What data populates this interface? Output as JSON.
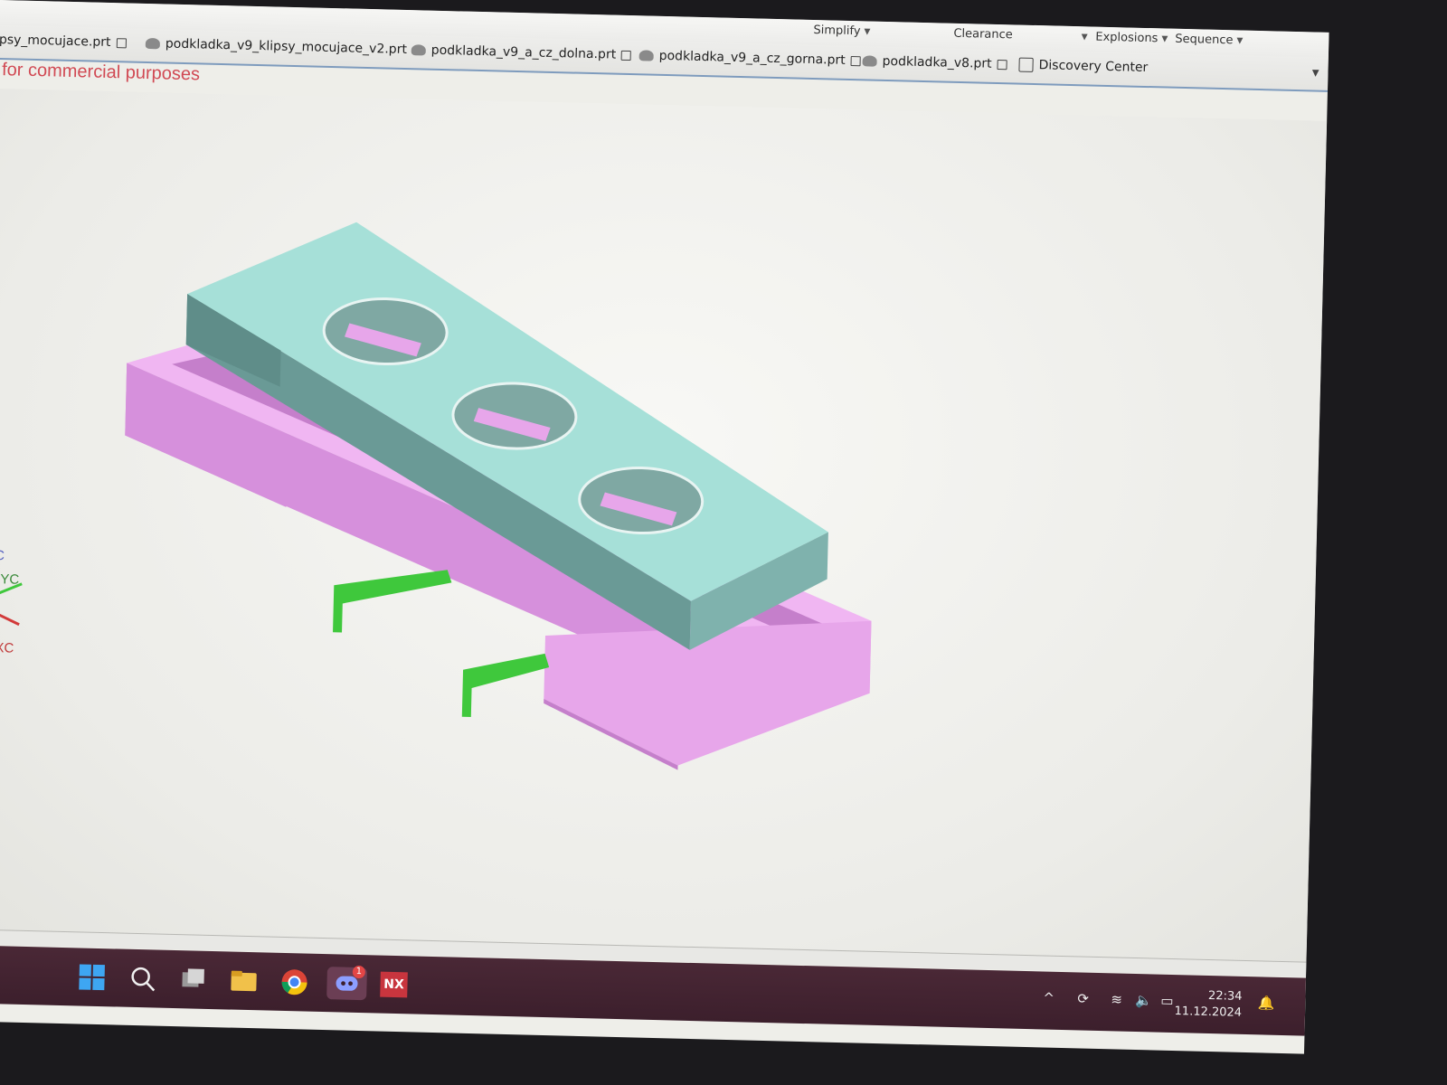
{
  "ribbon": {
    "simplify": "Simplify",
    "clearance": "Clearance",
    "explosions": "Explosions",
    "sequence": "Sequence"
  },
  "tabs": [
    {
      "label": "psy_mocujace.prt"
    },
    {
      "label": "podkladka_v9_klipsy_mocujace_v2.prt"
    },
    {
      "label": "podkladka_v9_a_cz_dolna.prt"
    },
    {
      "label": "podkladka_v9_a_cz_gorna.prt"
    },
    {
      "label": "podkladka_v8.prt"
    },
    {
      "label": "Discovery Center"
    }
  ],
  "watermark": "for commercial purposes",
  "triad": {
    "zc": "ZC",
    "yc": "YC",
    "xc": "XC"
  },
  "taskbar": {
    "discord_badge": "1",
    "nx_label": "NX",
    "time": "22:34",
    "date": "11.12.2024"
  },
  "colors": {
    "top_part": "#9fd9d0",
    "bottom_part": "#e7a6ea",
    "clip": "#3fc83c",
    "taskbar": "#452432"
  }
}
